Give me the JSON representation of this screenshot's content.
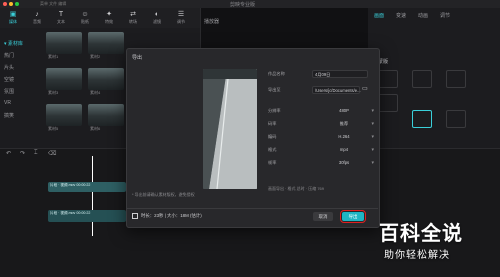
{
  "window": {
    "title": "剪映专业版",
    "menu_hint": "菜单 文件 编辑"
  },
  "toolbar": [
    {
      "label": "媒体",
      "icon": "media-icon",
      "active": true
    },
    {
      "label": "音频",
      "icon": "audio-icon"
    },
    {
      "label": "文本",
      "icon": "text-icon"
    },
    {
      "label": "贴纸",
      "icon": "sticker-icon"
    },
    {
      "label": "特效",
      "icon": "effects-icon"
    },
    {
      "label": "转场",
      "icon": "transition-icon"
    },
    {
      "label": "滤镜",
      "icon": "filter-icon"
    },
    {
      "label": "调节",
      "icon": "adjust-icon"
    }
  ],
  "left_nav": [
    {
      "label": "▾ 素材库",
      "active": true
    },
    {
      "label": "热门"
    },
    {
      "label": "片头"
    },
    {
      "label": "空镜"
    },
    {
      "label": "氛围"
    },
    {
      "label": "VR"
    },
    {
      "label": "搞笑"
    }
  ],
  "media_thumbs": [
    "素材1",
    "素材2",
    "素材3",
    "素材4",
    "素材5",
    "素材6"
  ],
  "player": {
    "title": "播放器"
  },
  "right_tabs": [
    {
      "label": "画面",
      "active": true
    },
    {
      "label": "变速"
    },
    {
      "label": "动画"
    },
    {
      "label": "调节"
    }
  ],
  "right_panel": {
    "section": "蒙版"
  },
  "timeline": {
    "tools": [
      "↶",
      "↷",
      "⌶",
      "⌫"
    ],
    "clip1_label": "片段 · 视频.mov 00:00:22",
    "clip2_label": "片段 · 视频.mov 00:00:22"
  },
  "modal": {
    "title": "导出",
    "fields": [
      {
        "label": "作品名称",
        "value": "4月09日"
      },
      {
        "label": "导出至",
        "value": "/Users/jc/Documents/e..."
      }
    ],
    "selects": [
      {
        "label": "分辨率",
        "value": "480P"
      },
      {
        "label": "码率",
        "value": "推荐"
      },
      {
        "label": "编码",
        "value": "H.264"
      },
      {
        "label": "格式",
        "value": "mp4"
      },
      {
        "label": "帧率",
        "value": "30fps"
      }
    ],
    "hint_right": "画面导出 · 格式 总时 · 压缩 769",
    "hint_left": "* 导出前请确认素材版权，避免侵权",
    "footer_info": "时长：23秒 | 大小：18M (估计)",
    "cancel_label": "取消",
    "export_label": "导出"
  },
  "watermark": {
    "line1": "百科全说",
    "line2": "助你轻松解决"
  }
}
